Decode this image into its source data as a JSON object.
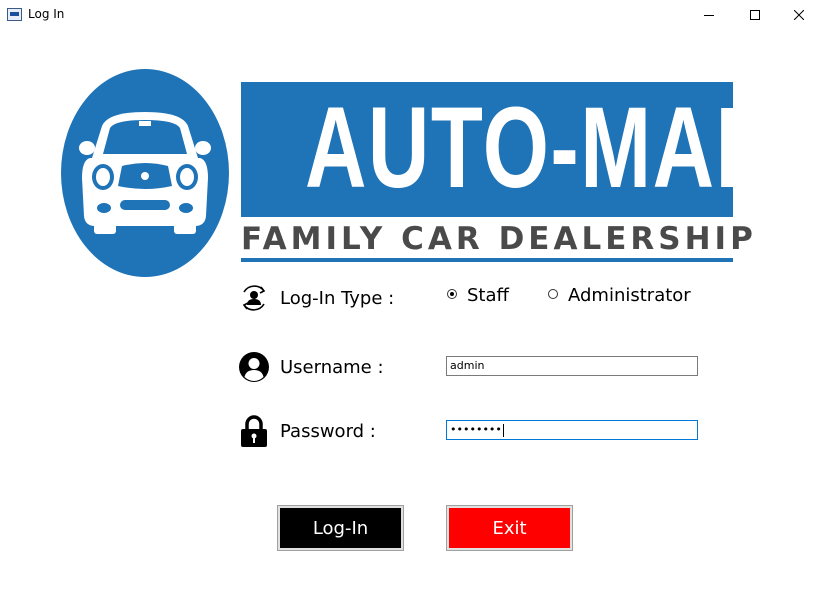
{
  "window": {
    "title": "Log In",
    "icon": "app-icon",
    "controls": [
      "minimize-icon",
      "maximize-icon",
      "close-icon"
    ]
  },
  "logo": {
    "brand": "AUTO-MART",
    "tagline": "FAMILY CAR DEALERSHIP",
    "icon": "car-icon",
    "brand_color": "#1f73b7",
    "tagline_color": "#4a4a4a"
  },
  "form": {
    "login_type": {
      "label": "Log-In Type :",
      "icon": "switch-user-icon",
      "options": [
        {
          "label": "Staff",
          "checked": true
        },
        {
          "label": "Administrator",
          "checked": false
        }
      ]
    },
    "username": {
      "label": "Username :",
      "icon": "user-icon",
      "value": "admin"
    },
    "password": {
      "label": "Password :",
      "icon": "lock-icon",
      "value": "••••••••"
    }
  },
  "buttons": {
    "login_label": "Log-In",
    "login_color": "#000000",
    "exit_label": "Exit",
    "exit_color": "#ff0000"
  }
}
